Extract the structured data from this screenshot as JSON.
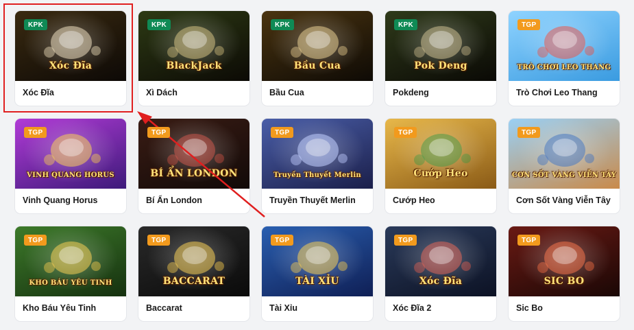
{
  "games": [
    {
      "title": "Xóc Đĩa",
      "badge": "KPK",
      "logo": "Xóc Đĩa",
      "bg": [
        "#3a2a10",
        "#0d0906"
      ],
      "accent": "#e8d6b0"
    },
    {
      "title": "Xì Dách",
      "badge": "KPK",
      "logo": "BlackJack",
      "bg": [
        "#2d3a14",
        "#0c0a05"
      ],
      "accent": "#c9b36a"
    },
    {
      "title": "Bầu Cua",
      "badge": "KPK",
      "logo": "Bầu Cua",
      "bg": [
        "#4a3410",
        "#0e0a05"
      ],
      "accent": "#e0c27c"
    },
    {
      "title": "Pokdeng",
      "badge": "KPK",
      "logo": "Pok Deng",
      "bg": [
        "#2f3a1a",
        "#0a0905"
      ],
      "accent": "#bfae7a"
    },
    {
      "title": "Trò Chơi Leo Thang",
      "badge": "TGP",
      "logo": "TRÒ CHƠI LEO THANG",
      "bg": [
        "#8fd3ff",
        "#3a9be0"
      ],
      "accent": "#e83b2e"
    },
    {
      "title": "Vinh Quang Horus",
      "badge": "TGP",
      "logo": "VINH QUANG HORUS",
      "bg": [
        "#b13bd6",
        "#3d1a7a"
      ],
      "accent": "#f5c23a"
    },
    {
      "title": "Bí Ẩn London",
      "badge": "TGP",
      "logo": "BÍ ẨN LONDON",
      "bg": [
        "#3a1c14",
        "#120a08"
      ],
      "accent": "#c0392b"
    },
    {
      "title": "Truyền Thuyết Merlin",
      "badge": "TGP",
      "logo": "Truyền Thuyết Merlin",
      "bg": [
        "#4a5ea8",
        "#1b1f4a"
      ],
      "accent": "#b7c6ff"
    },
    {
      "title": "Cướp Heo",
      "badge": "TGP",
      "logo": "Cướp Heo",
      "bg": [
        "#e8b84a",
        "#8a5a16"
      ],
      "accent": "#2f8a2a"
    },
    {
      "title": "Cơn Sốt Vàng Viễn Tây",
      "badge": "TGP",
      "logo": "CƠN SỐT VÀNG VIỄN TÂY",
      "bg": [
        "#9ad0f5",
        "#c98a4a"
      ],
      "accent": "#2a62b8"
    },
    {
      "title": "Kho Báu Yêu Tinh",
      "badge": "TGP",
      "logo": "KHO BÁU YÊU TINH",
      "bg": [
        "#3d7a2a",
        "#15300f"
      ],
      "accent": "#f3c335"
    },
    {
      "title": "Baccarat",
      "badge": "TGP",
      "logo": "BACCARAT",
      "bg": [
        "#2a2a2a",
        "#0a0a0a"
      ],
      "accent": "#f3c335"
    },
    {
      "title": "Tài Xỉu",
      "badge": "TGP",
      "logo": "TÀI XỈU",
      "bg": [
        "#2a5fb0",
        "#0f1f55"
      ],
      "accent": "#f3c335"
    },
    {
      "title": "Xóc Đĩa 2",
      "badge": "TGP",
      "logo": "Xóc Đĩa",
      "bg": [
        "#2a3a5a",
        "#0c1224"
      ],
      "accent": "#d94a3a"
    },
    {
      "title": "Sic Bo",
      "badge": "TGP",
      "logo": "SIC BO",
      "bg": [
        "#6a1a14",
        "#1a0705"
      ],
      "accent": "#f05a2a"
    }
  ]
}
